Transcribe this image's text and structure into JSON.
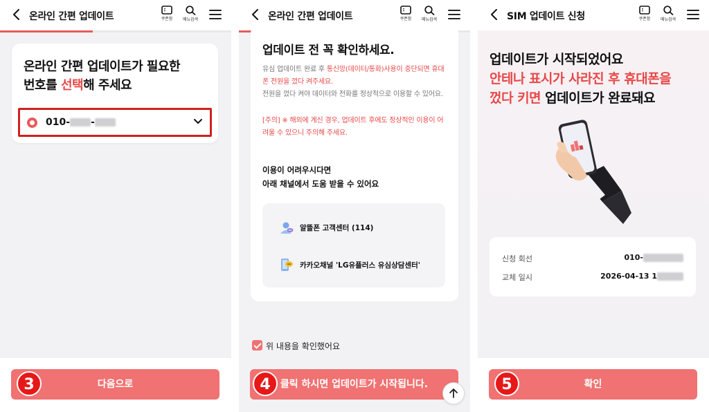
{
  "screen1": {
    "title": "온라인 간편 업데이트",
    "coupon_label": "쿠폰함",
    "search_label": "메뉴검색",
    "heading_line1": "온라인 간편 업데이트가 필요한",
    "heading_line2_pre": "번호를 ",
    "heading_line2_em": "선택",
    "heading_line2_post": "해 주세요",
    "phone_prefix": "010-",
    "phone_sep": "-",
    "next_button": "다음으로",
    "step": "3",
    "progress": 0.4
  },
  "screen2": {
    "title": "온라인 간편 업데이트",
    "coupon_label": "쿠폰함",
    "search_label": "메뉴검색",
    "heading": "업데이트 전 꼭 확인하세요.",
    "para1_pre": "유심 업데이트 완료 후 ",
    "para1_em": "통신망(데이터/통화)사용이 중단되면 휴대폰 전원을 껐다 켜주세요.",
    "para2": "전원을 껐다 켜야 데이터와 전화를 정상적으로 이용할 수 있어요.",
    "notice": "[주의] ※ 해외에 계신 경우, 업데이트 후에도 정상적인 이용이 어려울 수 있으니 주의해 주세요.",
    "help_line1": "이용이 어려우시다면",
    "help_line2": "아래 채널에서 도움 받을 수 있어요",
    "channel1": "알뜰폰 고객센터 (114)",
    "channel2": "카카오채널 'LG유플러스 유심상담센터'",
    "checkbox_label": "위 내용을 확인했어요",
    "cta": "클릭 하시면 업데이트가 시작됩니다.",
    "step": "4",
    "progress": 0.86
  },
  "screen3": {
    "title": "SIM 업데이트 신청",
    "coupon_label": "쿠폰함",
    "search_label": "메뉴검색",
    "line1": "업데이트가 시작되었어요",
    "line2": "안테나 표시가 사라진 후 휴대폰을",
    "line3_em": "껐다 키면",
    "line3_post": " 업데이트가 완료돼요",
    "row1_key": "신청 회선",
    "row1_val": "010-",
    "row2_key": "교체 일시",
    "row2_val": "2026-04-13 1",
    "confirm": "확인",
    "step": "5"
  },
  "colors": {
    "accent": "#f07272",
    "highlight": "#e84848",
    "badge": "#e61919"
  }
}
